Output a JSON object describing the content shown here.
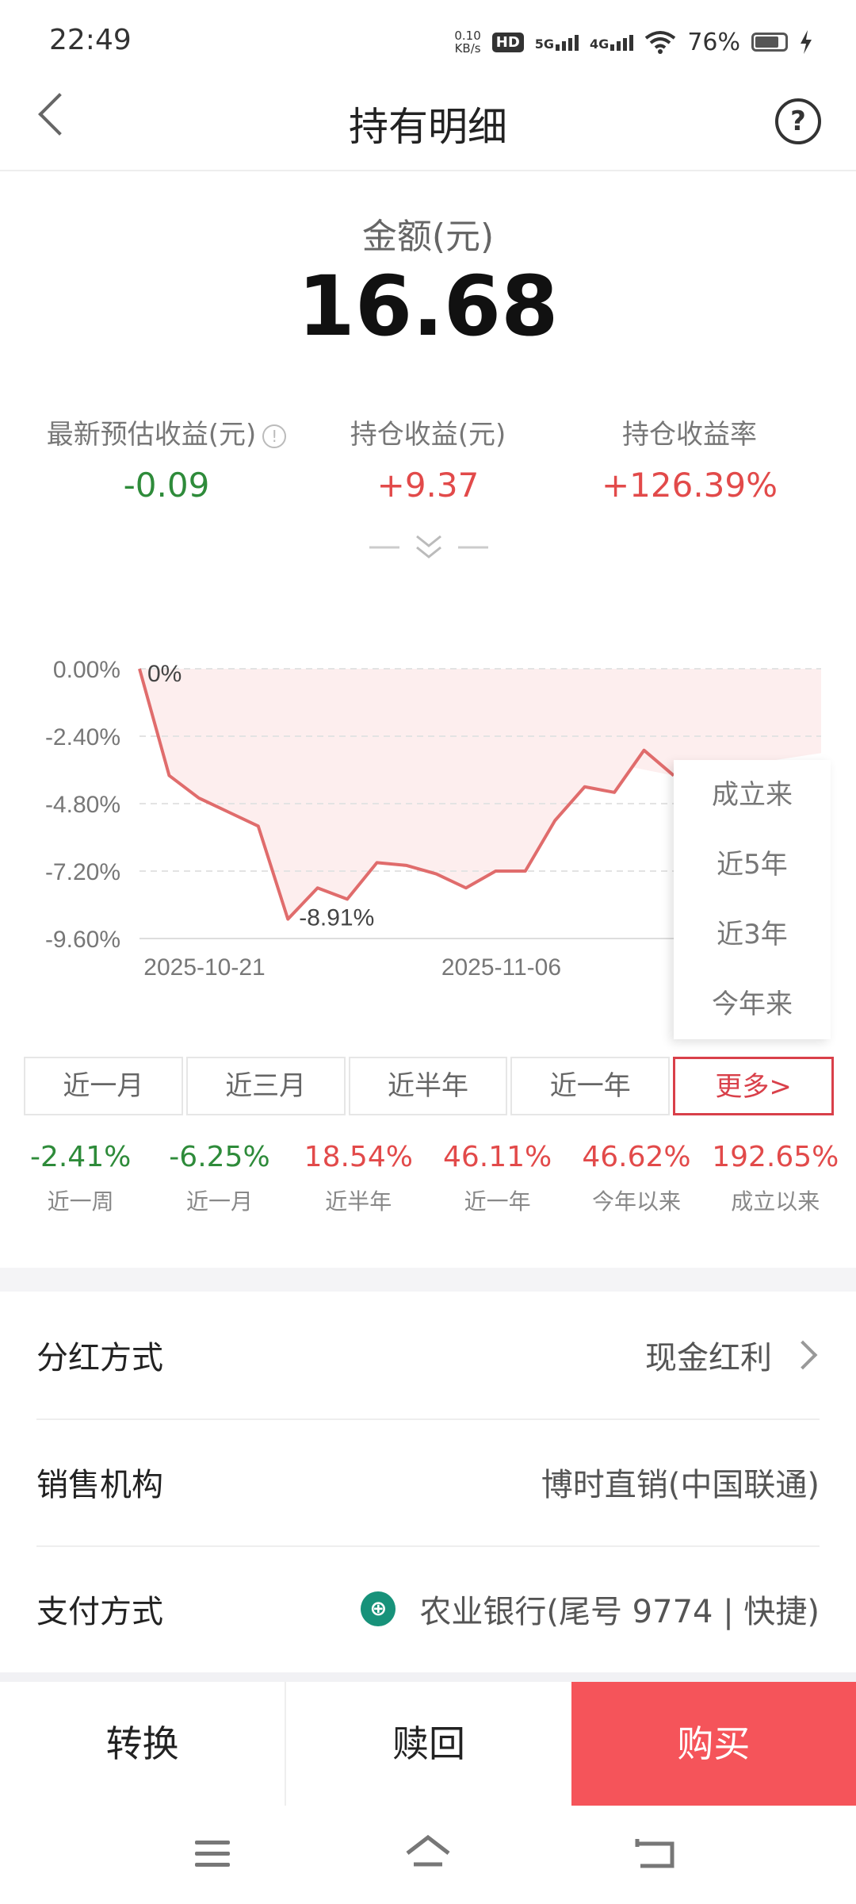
{
  "status": {
    "time": "22:49",
    "speed_top": "0.10",
    "speed_unit": "KB/s",
    "hd": "HD",
    "net1": "5G",
    "net2": "4G",
    "battery_pct": "76%"
  },
  "header": {
    "title": "持有明细",
    "help_symbol": "?"
  },
  "amount": {
    "label": "金额(元)",
    "value": "16.68"
  },
  "stats": [
    {
      "label": "最新预估收益(元)",
      "value": "-0.09",
      "tone": "green"
    },
    {
      "label": "持仓收益(元)",
      "value": "+9.37",
      "tone": "red"
    },
    {
      "label": "持仓收益率",
      "value": "+126.39%",
      "tone": "red"
    }
  ],
  "chart_data": {
    "type": "area",
    "y_ticks": [
      "0.00%",
      "-2.40%",
      "-4.80%",
      "-7.20%",
      "-9.60%"
    ],
    "ylim": [
      -9.6,
      0
    ],
    "x_ticks": [
      "2025-10-21",
      "2025-11-06"
    ],
    "series": [
      {
        "values": [
          0,
          -3.8,
          -4.6,
          -5.1,
          -5.6,
          -8.91,
          -7.8,
          -8.2,
          -6.9,
          -7.0,
          -7.3,
          -7.8,
          -7.2,
          -7.2,
          -5.4,
          -4.2,
          -4.4,
          -2.9,
          -3.8
        ]
      }
    ],
    "annotations": [
      {
        "label": "0%",
        "index": 0
      },
      {
        "label": "-8.91%",
        "index": 5
      }
    ],
    "line_color": "#e06c6c",
    "fill_color": "#fdeeee",
    "grid": "dashed"
  },
  "dropdown": {
    "items": [
      "成立来",
      "近5年",
      "近3年",
      "今年来"
    ]
  },
  "period_tabs": [
    "近一月",
    "近三月",
    "近半年",
    "近一年",
    "更多>"
  ],
  "returns": [
    {
      "value": "-2.41%",
      "label": "近一周",
      "tone": "green"
    },
    {
      "value": "-6.25%",
      "label": "近一月",
      "tone": "green"
    },
    {
      "value": "18.54%",
      "label": "近半年",
      "tone": "red"
    },
    {
      "value": "46.11%",
      "label": "近一年",
      "tone": "red"
    },
    {
      "value": "46.62%",
      "label": "今年以来",
      "tone": "red"
    },
    {
      "value": "192.65%",
      "label": "成立以来",
      "tone": "red"
    }
  ],
  "details": {
    "dividend": {
      "key": "分红方式",
      "value": "现金红利"
    },
    "sales": {
      "key": "销售机构",
      "value": "博时直销(中国联通)"
    },
    "payment": {
      "key": "支付方式",
      "value": "农业银行(尾号 9774 | 快捷)",
      "icon": "abc-bank-icon"
    }
  },
  "actions": {
    "convert": "转换",
    "redeem": "赎回",
    "buy": "购买"
  },
  "colors": {
    "green": "#2e8b3a",
    "red": "#e24a4a",
    "buy_bg": "#f5545a",
    "accent_border": "#d9404a"
  }
}
